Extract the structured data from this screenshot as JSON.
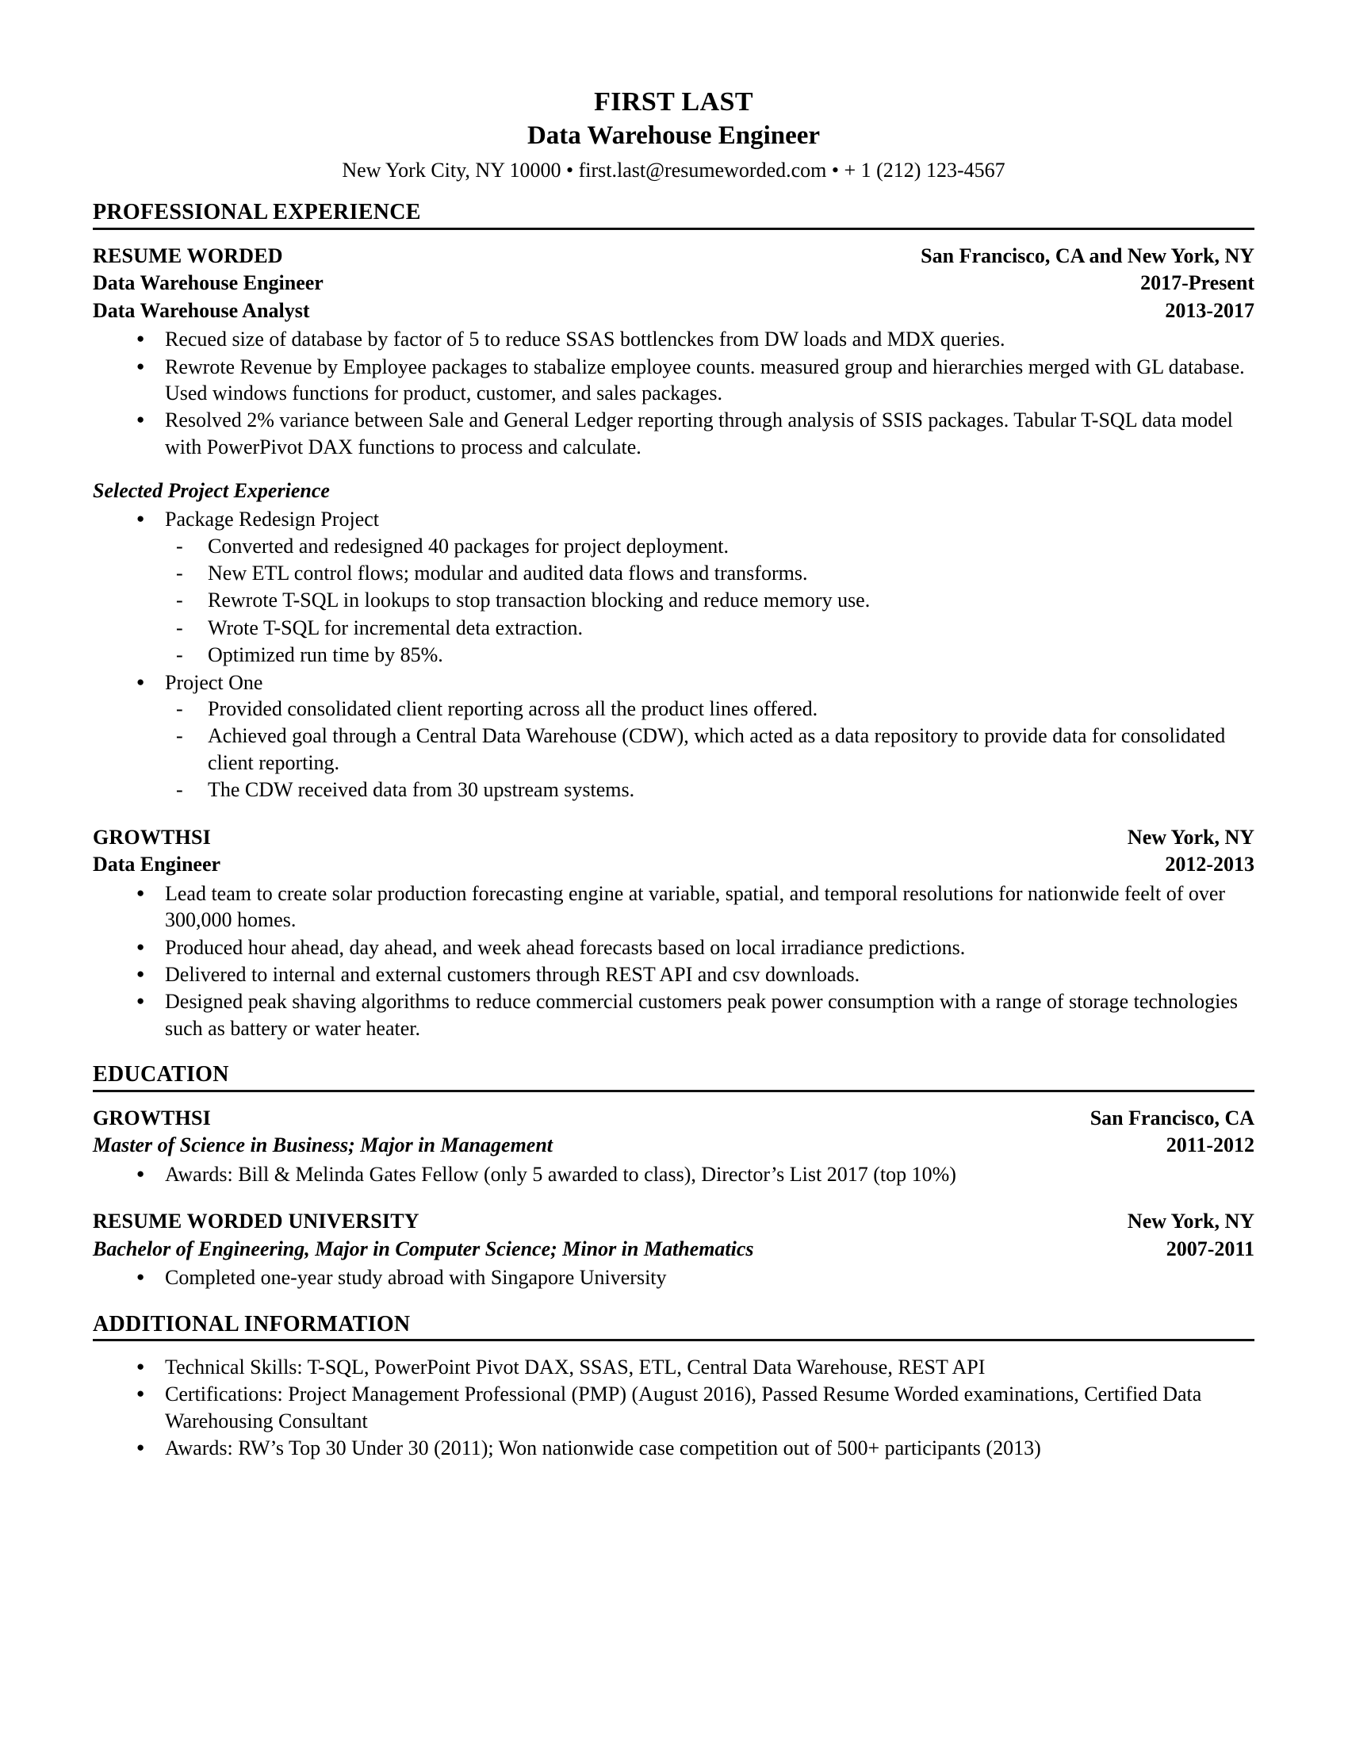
{
  "header": {
    "name": "FIRST LAST",
    "headline": "Data Warehouse Engineer",
    "contact": "New York City, NY 10000 • first.last@resumeworded.com • + 1 (212) 123-4567"
  },
  "sections": {
    "experience": {
      "title": "PROFESSIONAL EXPERIENCE",
      "jobs": [
        {
          "org": "RESUME WORDED",
          "location": "San Francisco, CA and New York, NY",
          "role1": "Data Warehouse Engineer",
          "dates1": "2017-Present",
          "role2": "Data Warehouse Analyst",
          "dates2": "2013-2017",
          "bullets": [
            "Recued size of database by factor of 5 to reduce SSAS bottlenckes from DW loads and MDX queries.",
            "Rewrote Revenue by Employee packages to stabalize employee counts. measured group and hierarchies merged with GL database. Used windows functions for product, customer, and sales packages.",
            "Resolved 2% variance between Sale and General Ledger reporting through analysis of SSIS packages. Tabular T-SQL data model with PowerPivot DAX functions to process and calculate."
          ],
          "projects_heading": "Selected Project Experience",
          "projects": [
            {
              "name": "Package Redesign Project",
              "items": [
                "Converted and redesigned 40 packages for project deployment.",
                "New ETL control flows; modular and audited data flows and transforms.",
                "Rewrote T-SQL in lookups to stop transaction blocking and reduce memory use.",
                "Wrote T-SQL for incremental deta extraction.",
                "Optimized run time by 85%."
              ]
            },
            {
              "name": "Project One",
              "items": [
                "Provided consolidated client reporting across all the product lines offered.",
                "Achieved goal through a Central Data Warehouse (CDW), which acted as a data repository to provide data for consolidated client reporting.",
                "The CDW received data from 30 upstream systems."
              ]
            }
          ]
        },
        {
          "org": "GROWTHSI",
          "location": "New York, NY",
          "role1": "Data Engineer",
          "dates1": "2012-2013",
          "bullets": [
            "Lead team to create solar production forecasting engine at variable, spatial, and temporal resolutions for nationwide feelt of over 300,000 homes.",
            "Produced hour ahead, day ahead, and week ahead forecasts based on local irradiance predictions.",
            "Delivered to internal and external customers through REST API and csv downloads.",
            "Designed peak shaving algorithms to reduce commercial customers peak power consumption with a range of storage technologies such as battery or water heater."
          ]
        }
      ]
    },
    "education": {
      "title": "EDUCATION",
      "schools": [
        {
          "org": "GROWTHSI",
          "location": "San Francisco, CA",
          "degree": "Master of Science in Business; Major in Management",
          "dates": "2011-2012",
          "bullets": [
            "Awards: Bill & Melinda Gates Fellow (only 5 awarded to class), Director’s List 2017 (top 10%)"
          ]
        },
        {
          "org": "RESUME WORDED UNIVERSITY",
          "location": "New York, NY",
          "degree": "Bachelor of Engineering, Major in Computer Science; Minor in Mathematics",
          "dates": "2007-2011",
          "bullets": [
            "Completed one-year study abroad with Singapore University"
          ]
        }
      ]
    },
    "additional": {
      "title": "ADDITIONAL INFORMATION",
      "bullets": [
        "Technical Skills: T-SQL, PowerPoint Pivot DAX, SSAS, ETL, Central Data Warehouse, REST API",
        "Certifications: Project Management Professional (PMP) (August 2016), Passed Resume Worded examinations, Certified Data Warehousing Consultant",
        "Awards: RW’s Top 30 Under 30 (2011); Won nationwide case competition out of 500+ participants (2013)"
      ]
    }
  }
}
